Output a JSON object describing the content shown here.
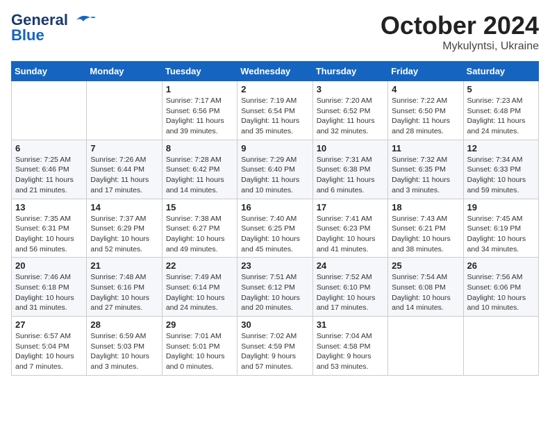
{
  "header": {
    "logo_line1": "General",
    "logo_line2": "Blue",
    "month": "October 2024",
    "location": "Mykulyntsi, Ukraine"
  },
  "weekdays": [
    "Sunday",
    "Monday",
    "Tuesday",
    "Wednesday",
    "Thursday",
    "Friday",
    "Saturday"
  ],
  "weeks": [
    [
      {
        "day": "",
        "detail": ""
      },
      {
        "day": "",
        "detail": ""
      },
      {
        "day": "1",
        "detail": "Sunrise: 7:17 AM\nSunset: 6:56 PM\nDaylight: 11 hours and 39 minutes."
      },
      {
        "day": "2",
        "detail": "Sunrise: 7:19 AM\nSunset: 6:54 PM\nDaylight: 11 hours and 35 minutes."
      },
      {
        "day": "3",
        "detail": "Sunrise: 7:20 AM\nSunset: 6:52 PM\nDaylight: 11 hours and 32 minutes."
      },
      {
        "day": "4",
        "detail": "Sunrise: 7:22 AM\nSunset: 6:50 PM\nDaylight: 11 hours and 28 minutes."
      },
      {
        "day": "5",
        "detail": "Sunrise: 7:23 AM\nSunset: 6:48 PM\nDaylight: 11 hours and 24 minutes."
      }
    ],
    [
      {
        "day": "6",
        "detail": "Sunrise: 7:25 AM\nSunset: 6:46 PM\nDaylight: 11 hours and 21 minutes."
      },
      {
        "day": "7",
        "detail": "Sunrise: 7:26 AM\nSunset: 6:44 PM\nDaylight: 11 hours and 17 minutes."
      },
      {
        "day": "8",
        "detail": "Sunrise: 7:28 AM\nSunset: 6:42 PM\nDaylight: 11 hours and 14 minutes."
      },
      {
        "day": "9",
        "detail": "Sunrise: 7:29 AM\nSunset: 6:40 PM\nDaylight: 11 hours and 10 minutes."
      },
      {
        "day": "10",
        "detail": "Sunrise: 7:31 AM\nSunset: 6:38 PM\nDaylight: 11 hours and 6 minutes."
      },
      {
        "day": "11",
        "detail": "Sunrise: 7:32 AM\nSunset: 6:35 PM\nDaylight: 11 hours and 3 minutes."
      },
      {
        "day": "12",
        "detail": "Sunrise: 7:34 AM\nSunset: 6:33 PM\nDaylight: 10 hours and 59 minutes."
      }
    ],
    [
      {
        "day": "13",
        "detail": "Sunrise: 7:35 AM\nSunset: 6:31 PM\nDaylight: 10 hours and 56 minutes."
      },
      {
        "day": "14",
        "detail": "Sunrise: 7:37 AM\nSunset: 6:29 PM\nDaylight: 10 hours and 52 minutes."
      },
      {
        "day": "15",
        "detail": "Sunrise: 7:38 AM\nSunset: 6:27 PM\nDaylight: 10 hours and 49 minutes."
      },
      {
        "day": "16",
        "detail": "Sunrise: 7:40 AM\nSunset: 6:25 PM\nDaylight: 10 hours and 45 minutes."
      },
      {
        "day": "17",
        "detail": "Sunrise: 7:41 AM\nSunset: 6:23 PM\nDaylight: 10 hours and 41 minutes."
      },
      {
        "day": "18",
        "detail": "Sunrise: 7:43 AM\nSunset: 6:21 PM\nDaylight: 10 hours and 38 minutes."
      },
      {
        "day": "19",
        "detail": "Sunrise: 7:45 AM\nSunset: 6:19 PM\nDaylight: 10 hours and 34 minutes."
      }
    ],
    [
      {
        "day": "20",
        "detail": "Sunrise: 7:46 AM\nSunset: 6:18 PM\nDaylight: 10 hours and 31 minutes."
      },
      {
        "day": "21",
        "detail": "Sunrise: 7:48 AM\nSunset: 6:16 PM\nDaylight: 10 hours and 27 minutes."
      },
      {
        "day": "22",
        "detail": "Sunrise: 7:49 AM\nSunset: 6:14 PM\nDaylight: 10 hours and 24 minutes."
      },
      {
        "day": "23",
        "detail": "Sunrise: 7:51 AM\nSunset: 6:12 PM\nDaylight: 10 hours and 20 minutes."
      },
      {
        "day": "24",
        "detail": "Sunrise: 7:52 AM\nSunset: 6:10 PM\nDaylight: 10 hours and 17 minutes."
      },
      {
        "day": "25",
        "detail": "Sunrise: 7:54 AM\nSunset: 6:08 PM\nDaylight: 10 hours and 14 minutes."
      },
      {
        "day": "26",
        "detail": "Sunrise: 7:56 AM\nSunset: 6:06 PM\nDaylight: 10 hours and 10 minutes."
      }
    ],
    [
      {
        "day": "27",
        "detail": "Sunrise: 6:57 AM\nSunset: 5:04 PM\nDaylight: 10 hours and 7 minutes."
      },
      {
        "day": "28",
        "detail": "Sunrise: 6:59 AM\nSunset: 5:03 PM\nDaylight: 10 hours and 3 minutes."
      },
      {
        "day": "29",
        "detail": "Sunrise: 7:01 AM\nSunset: 5:01 PM\nDaylight: 10 hours and 0 minutes."
      },
      {
        "day": "30",
        "detail": "Sunrise: 7:02 AM\nSunset: 4:59 PM\nDaylight: 9 hours and 57 minutes."
      },
      {
        "day": "31",
        "detail": "Sunrise: 7:04 AM\nSunset: 4:58 PM\nDaylight: 9 hours and 53 minutes."
      },
      {
        "day": "",
        "detail": ""
      },
      {
        "day": "",
        "detail": ""
      }
    ]
  ]
}
